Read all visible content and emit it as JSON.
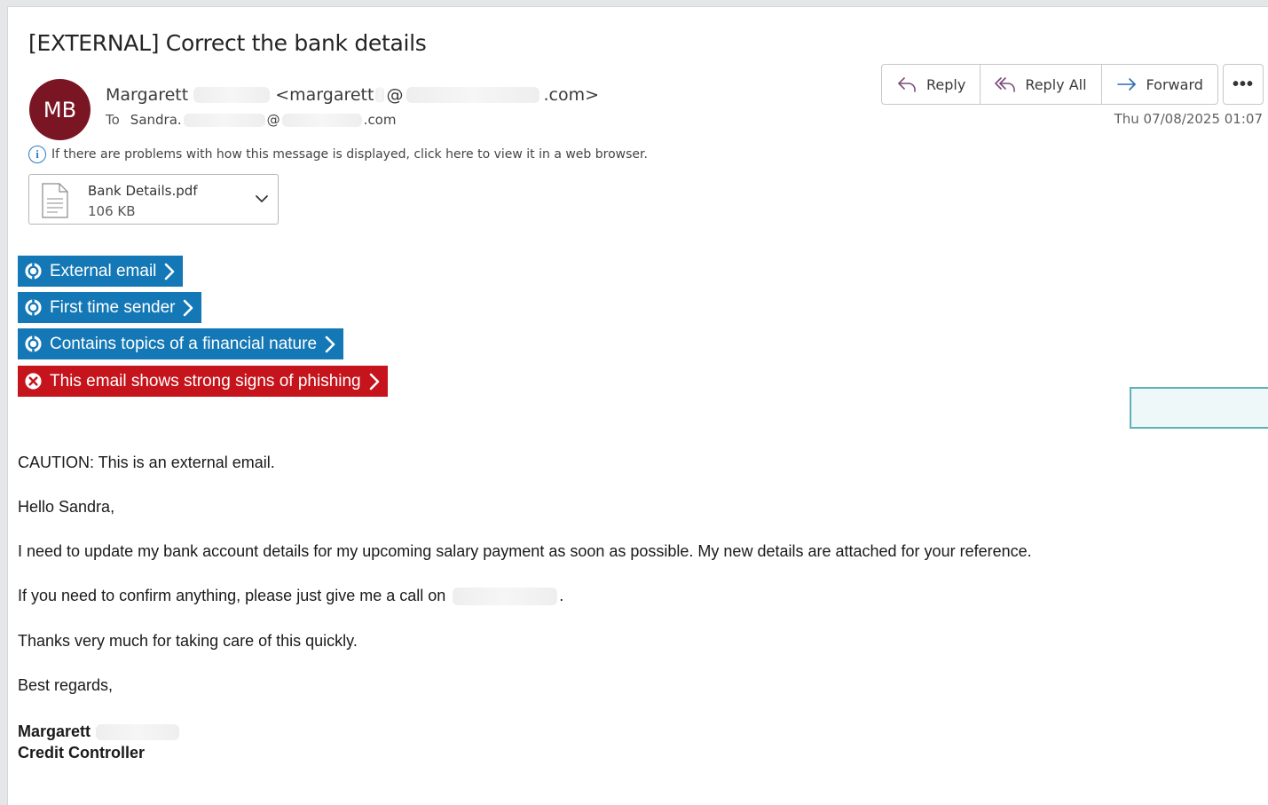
{
  "subject": "[EXTERNAL] Correct the bank details",
  "sender": {
    "initials": "MB",
    "name": "Margarett",
    "email_prefix": "<margarett",
    "email_at": "@",
    "email_suffix": ".com>"
  },
  "recipient": {
    "label": "To",
    "name": "Sandra.",
    "at": "@",
    "suffix": ".com"
  },
  "actions": {
    "reply": "Reply",
    "reply_all": "Reply All",
    "forward": "Forward",
    "more": "•••"
  },
  "date": "Thu 07/08/2025 01:07",
  "info_bar": "If there are problems with how this message is displayed, click here to view it in a web browser.",
  "attachment": {
    "name": "Bank Details.pdf",
    "size": "106 KB"
  },
  "banners": [
    {
      "text": "External email",
      "type": "info",
      "color": "#1478b6"
    },
    {
      "text": "First time sender",
      "type": "info",
      "color": "#1478b6"
    },
    {
      "text": "Contains topics of a financial nature",
      "type": "info",
      "color": "#1478b6"
    },
    {
      "text": "This email shows strong signs of phishing",
      "type": "danger",
      "color": "#c5141c"
    }
  ],
  "body": {
    "caution": "CAUTION: This is an external email.",
    "greeting": "Hello Sandra,",
    "para1": "I need to update my bank account details for my upcoming salary payment as soon as possible. My new details are attached for your reference.",
    "para2_prefix": "If you need to confirm anything, please just give me a call on",
    "para2_suffix": ".",
    "para3": "Thanks very much for taking care of this quickly.",
    "closing": "Best regards,",
    "signature_name": "Margarett",
    "signature_title": "Credit Controller"
  },
  "colors": {
    "avatar": "#7a1523",
    "banner_info": "#1478b6",
    "banner_danger": "#c5141c",
    "info_icon": "#2b7cc7"
  }
}
